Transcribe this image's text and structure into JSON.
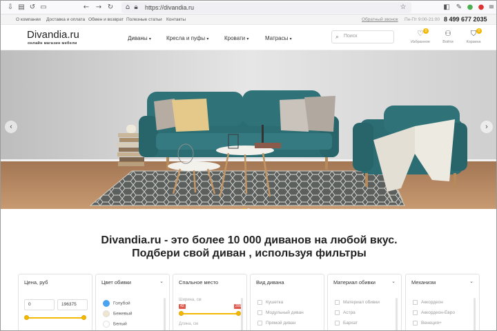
{
  "browser": {
    "url": "https://divandia.ru"
  },
  "topline": {
    "links": [
      "О компании",
      "Доставка и оплата",
      "Обмен и возврат",
      "Полезные статьи",
      "Контакты"
    ],
    "callback": "Обратный звонок",
    "hours": "Пн-Пт 9:00-21:00",
    "phone": "8 499 677 2035"
  },
  "header": {
    "logo": "Divandia.ru",
    "tagline": "онлайн магазин мебели",
    "nav": [
      "Диваны",
      "Кресла и пуфы",
      "Кровати",
      "Матрасы"
    ],
    "search_placeholder": "Поиск",
    "favorites_label": "Избранное",
    "login_label": "Войти",
    "cart_label": "Корзина",
    "favorites_count": "0",
    "cart_count": "0"
  },
  "hero": {
    "prev_arrow": "‹",
    "next_arrow": "›"
  },
  "headline": {
    "line1": "Divandia.ru - это более 10 000 диванов на любой вкус.",
    "line2": "Подбери свой диван , используя фильтры"
  },
  "filters": {
    "price": {
      "title": "Цена, руб",
      "min": "0",
      "max": "196375"
    },
    "color": {
      "title": "Цвет обивки",
      "options": [
        {
          "label": "Голубой",
          "color": "#4aa3f0"
        },
        {
          "label": "Бежевый",
          "color": "#efe6cf"
        },
        {
          "label": "Белый",
          "color": "#ffffff"
        }
      ]
    },
    "sleeping": {
      "title": "Спальное место",
      "width_label": "Ширина, см",
      "width_min": "42",
      "width_max": "200",
      "length_label": "Длина, см"
    },
    "type": {
      "title": "Вид дивана",
      "options": [
        "Кушетка",
        "Модульный диван",
        "Прямой диван"
      ]
    },
    "material": {
      "title": "Материал обивки",
      "options": [
        "Материал обивки",
        "Астра",
        "Бархат"
      ]
    },
    "mechanism": {
      "title": "Механизм",
      "options": [
        "Аккордеон",
        "Аккордеон-Евро",
        "Венеция+"
      ]
    }
  },
  "colors": {
    "accent": "#f5b800",
    "sofa": "#2e6f75",
    "floor": "#b98c62",
    "wall": "#d9d9d9"
  }
}
